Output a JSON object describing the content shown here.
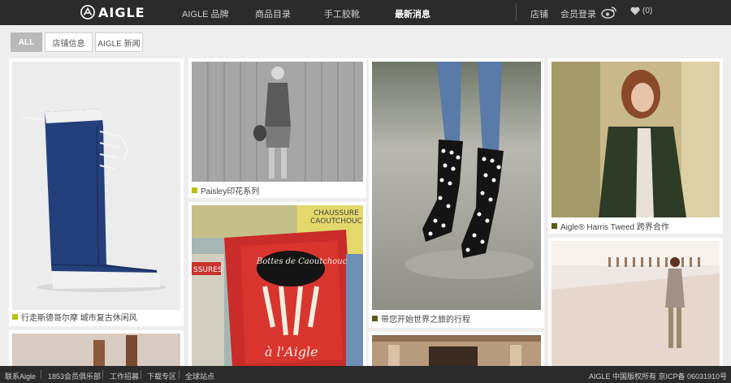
{
  "header": {
    "logo_text": "AIGLE",
    "nav": [
      "AIGLE 品牌",
      "商品目录",
      "手工胶靴",
      "最新消息"
    ],
    "active_nav": "最新消息",
    "stores": "店铺",
    "login": "会员登录",
    "favorites_count": "(0)"
  },
  "filters": [
    "ALL",
    "店铺信息",
    "AIGLE 新闻"
  ],
  "active_filter": "ALL",
  "tiles": [
    {
      "caption": "行走斯德哥尔摩 城市复古休闲风",
      "square_color": "#b5c21a",
      "icon": "blue-rain-boot"
    },
    {
      "caption": "Paisley印花系列",
      "square_color": "#b5c21a",
      "icon": "woman-wooden-wall-photo"
    },
    {
      "caption": "",
      "icon": "vintage-posters-photo",
      "poster_text": [
        "Bottes de Caoutchouc",
        "à l'Aigle",
        "CHAUSSURE",
        "CAOUTCHOUC",
        "SSURES"
      ]
    },
    {
      "caption": "带您开始世界之旅的行程",
      "square_color": "#5a5a14",
      "icon": "jumping-polka-dot-boots-photo"
    },
    {
      "caption": "Aigle® Harris Tweed 跨界合作",
      "square_color": "#5a5a14",
      "icon": "woman-green-jacket-photo"
    },
    {
      "caption": "",
      "icon": "woman-beach-walk-photo"
    },
    {
      "caption": "",
      "icon": "legs-boots-photo"
    },
    {
      "caption": "",
      "icon": "interior-room-photo"
    }
  ],
  "footer": {
    "links": [
      "联系Aigle",
      "1853会员俱乐部",
      "工作招募",
      "下载专区",
      "全球站点"
    ],
    "copyright": "AIGLE 中国版权所有 京ICP备 0603191​0号"
  }
}
